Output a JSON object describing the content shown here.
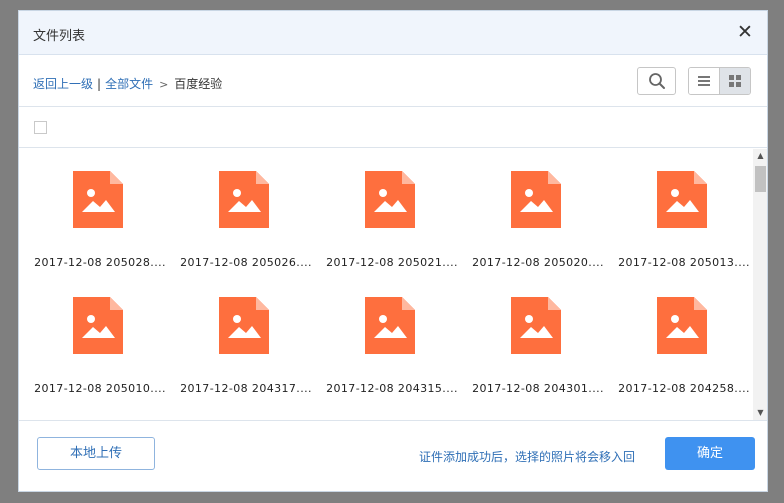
{
  "dialog": {
    "title": "文件列表",
    "close_symbol": "✕"
  },
  "breadcrumb": {
    "back": "返回上一级",
    "separator": "|",
    "all_files": "全部文件",
    "arrow": ">",
    "current": "百度经验"
  },
  "toolbar": {
    "search_icon": "search-icon",
    "view_list_icon": "list-view-icon",
    "view_grid_icon": "grid-view-icon",
    "active_view": "grid"
  },
  "files": [
    {
      "name": "2017-12-08 205028...."
    },
    {
      "name": "2017-12-08 205026...."
    },
    {
      "name": "2017-12-08 205021...."
    },
    {
      "name": "2017-12-08 205020...."
    },
    {
      "name": "2017-12-08 205013...."
    },
    {
      "name": "2017-12-08 205010...."
    },
    {
      "name": "2017-12-08 204317...."
    },
    {
      "name": "2017-12-08 204315...."
    },
    {
      "name": "2017-12-08 204301...."
    },
    {
      "name": "2017-12-08 204258...."
    }
  ],
  "footer": {
    "upload_label": "本地上传",
    "hint": "证件添加成功后，选择的照片将会移入回",
    "confirm_label": "确定"
  },
  "colors": {
    "file_icon": "#fe6f3e",
    "accent": "#3f92f0",
    "link": "#2f6fb6"
  }
}
